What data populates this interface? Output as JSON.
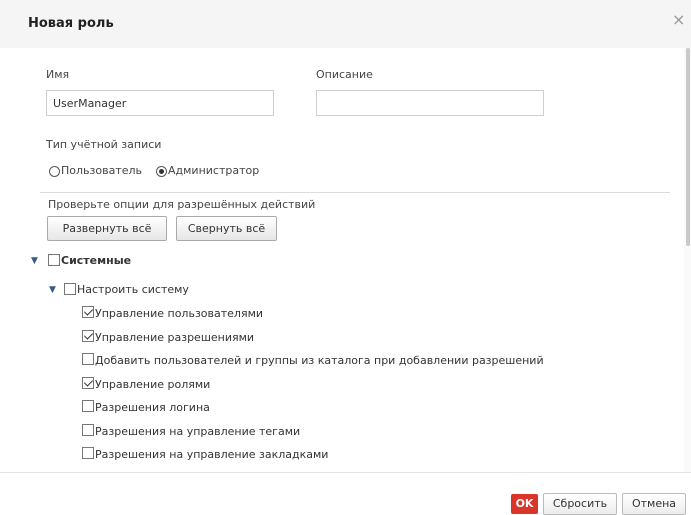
{
  "dialog": {
    "title": "Новая роль",
    "close_glyph": "×"
  },
  "form": {
    "name_label": "Имя",
    "name_value": "UserManager",
    "description_label": "Описание",
    "description_value": "",
    "account_type_label": "Тип учётной записи",
    "account_types": [
      {
        "label": "Пользователь",
        "selected": false
      },
      {
        "label": "Администратор",
        "selected": true
      }
    ],
    "permissions_hint": "Проверьте опции для разрешённых действий",
    "expand_all": "Развернуть всё",
    "collapse_all": "Свернуть всё"
  },
  "tree": {
    "root": {
      "label": "Системные",
      "checked": false,
      "expanded": true
    },
    "group": {
      "label": "Настроить систему",
      "checked": false,
      "expanded": true
    },
    "items": [
      {
        "label": "Управление пользователями",
        "checked": true
      },
      {
        "label": "Управление разрешениями",
        "checked": true
      },
      {
        "label": "Добавить пользователей и группы из каталога при добавлении разрешений",
        "checked": false
      },
      {
        "label": "Управление ролями",
        "checked": true
      },
      {
        "label": "Разрешения логина",
        "checked": false
      },
      {
        "label": "Разрешения на управление тегами",
        "checked": false
      },
      {
        "label": "Разрешения на управление закладками",
        "checked": false
      }
    ]
  },
  "footer": {
    "ok": "OK",
    "reset": "Сбросить",
    "cancel": "Отмена"
  },
  "colors": {
    "ok_button": "#d9352a",
    "header_bg": "#f5f5f5"
  }
}
